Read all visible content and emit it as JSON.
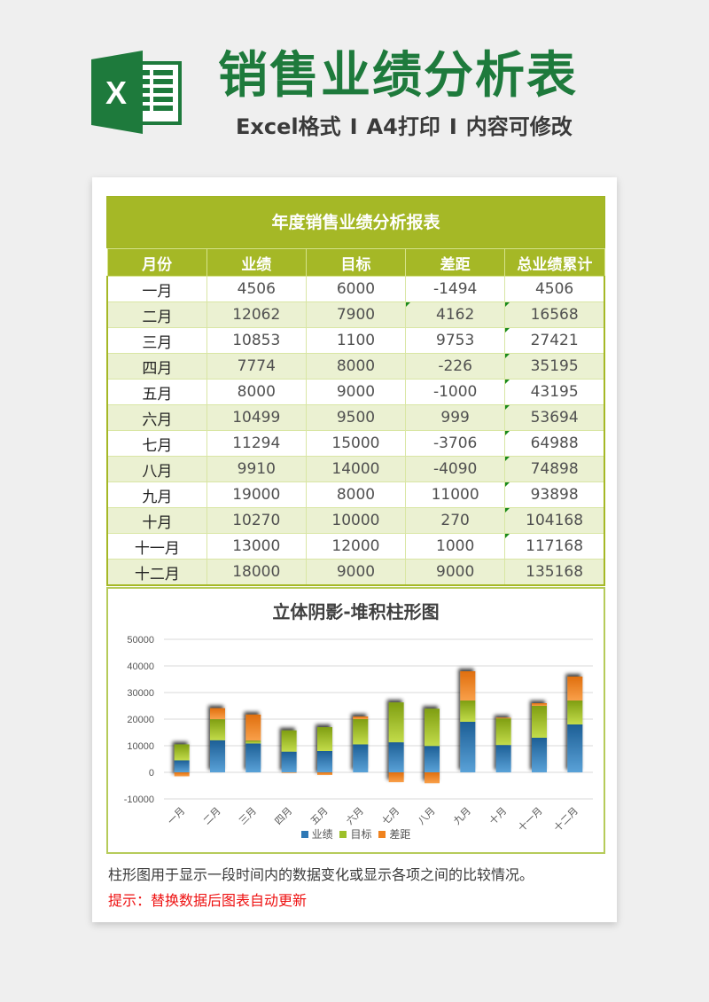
{
  "header": {
    "title": "销售业绩分析表",
    "subtitle_parts": [
      "Excel格式",
      "A4打印",
      "内容可修改"
    ],
    "separator": "I",
    "logo_letter": "X"
  },
  "report": {
    "title": "年度销售业绩分析报表",
    "columns": [
      "月份",
      "业绩",
      "目标",
      "差距",
      "总业绩累计"
    ],
    "rows": [
      {
        "month": "一月",
        "actual": "4506",
        "target": "6000",
        "gap": "-1494",
        "cumulative": "4506",
        "flag_gap": false,
        "flag_cum": false
      },
      {
        "month": "二月",
        "actual": "12062",
        "target": "7900",
        "gap": "4162",
        "cumulative": "16568",
        "flag_gap": true,
        "flag_cum": true
      },
      {
        "month": "三月",
        "actual": "10853",
        "target": "1100",
        "gap": "9753",
        "cumulative": "27421",
        "flag_gap": false,
        "flag_cum": true
      },
      {
        "month": "四月",
        "actual": "7774",
        "target": "8000",
        "gap": "-226",
        "cumulative": "35195",
        "flag_gap": false,
        "flag_cum": true
      },
      {
        "month": "五月",
        "actual": "8000",
        "target": "9000",
        "gap": "-1000",
        "cumulative": "43195",
        "flag_gap": false,
        "flag_cum": true
      },
      {
        "month": "六月",
        "actual": "10499",
        "target": "9500",
        "gap": "999",
        "cumulative": "53694",
        "flag_gap": false,
        "flag_cum": true
      },
      {
        "month": "七月",
        "actual": "11294",
        "target": "15000",
        "gap": "-3706",
        "cumulative": "64988",
        "flag_gap": false,
        "flag_cum": true
      },
      {
        "month": "八月",
        "actual": "9910",
        "target": "14000",
        "gap": "-4090",
        "cumulative": "74898",
        "flag_gap": false,
        "flag_cum": true
      },
      {
        "month": "九月",
        "actual": "19000",
        "target": "8000",
        "gap": "11000",
        "cumulative": "93898",
        "flag_gap": false,
        "flag_cum": true
      },
      {
        "month": "十月",
        "actual": "10270",
        "target": "10000",
        "gap": "270",
        "cumulative": "104168",
        "flag_gap": false,
        "flag_cum": true
      },
      {
        "month": "十一月",
        "actual": "13000",
        "target": "12000",
        "gap": "1000",
        "cumulative": "117168",
        "flag_gap": false,
        "flag_cum": true
      },
      {
        "month": "十二月",
        "actual": "18000",
        "target": "9000",
        "gap": "9000",
        "cumulative": "135168",
        "flag_gap": false,
        "flag_cum": false
      }
    ],
    "colors": {
      "header_bg": "#a5b826",
      "row_alt": "#ebf1d2",
      "flag": "#1a8a1a"
    }
  },
  "chart_data": {
    "type": "bar",
    "stacked": true,
    "title": "立体阴影-堆积柱形图",
    "xlabel": "",
    "ylabel": "",
    "categories": [
      "一月",
      "二月",
      "三月",
      "四月",
      "五月",
      "六月",
      "七月",
      "八月",
      "九月",
      "十月",
      "十一月",
      "十二月"
    ],
    "series": [
      {
        "name": "业绩",
        "color": "#2e78b5",
        "values": [
          4506,
          12062,
          10853,
          7774,
          8000,
          10499,
          11294,
          9910,
          19000,
          10270,
          13000,
          18000
        ]
      },
      {
        "name": "目标",
        "color": "#9dc02a",
        "values": [
          6000,
          7900,
          1100,
          8000,
          9000,
          9500,
          15000,
          14000,
          8000,
          10000,
          12000,
          9000
        ]
      },
      {
        "name": "差距",
        "color": "#f0821e",
        "values": [
          -1494,
          4162,
          9753,
          -226,
          -1000,
          999,
          -3706,
          -4090,
          11000,
          270,
          1000,
          9000
        ]
      }
    ],
    "yticks": [
      "50000",
      "40000",
      "30000",
      "20000",
      "10000",
      "0",
      "-10000"
    ],
    "ylim": [
      -10000,
      50000
    ],
    "grid": true,
    "legend": "bottom"
  },
  "footer": {
    "description": "柱形图用于显示一段时间内的数据变化或显示各项之间的比较情况。",
    "tip": "提示：替换数据后图表自动更新"
  }
}
